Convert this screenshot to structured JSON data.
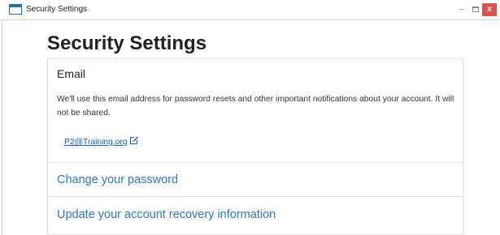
{
  "window": {
    "title": "Security Settings",
    "minimize_glyph": "–",
    "close_glyph": "x"
  },
  "page": {
    "title": "Security Settings"
  },
  "email_section": {
    "heading": "Email",
    "description": "We'll use this email address for password resets and other important notifications about your account. It will not be shared.",
    "address": "P2@Training.org",
    "edit_icon": "edit-icon"
  },
  "password_section": {
    "link": "Change your password"
  },
  "recovery_section": {
    "link": "Update your account recovery information"
  },
  "colors": {
    "link": "#2f78c4",
    "close_button": "#d9534f",
    "window_icon": "#1f6fb5"
  }
}
